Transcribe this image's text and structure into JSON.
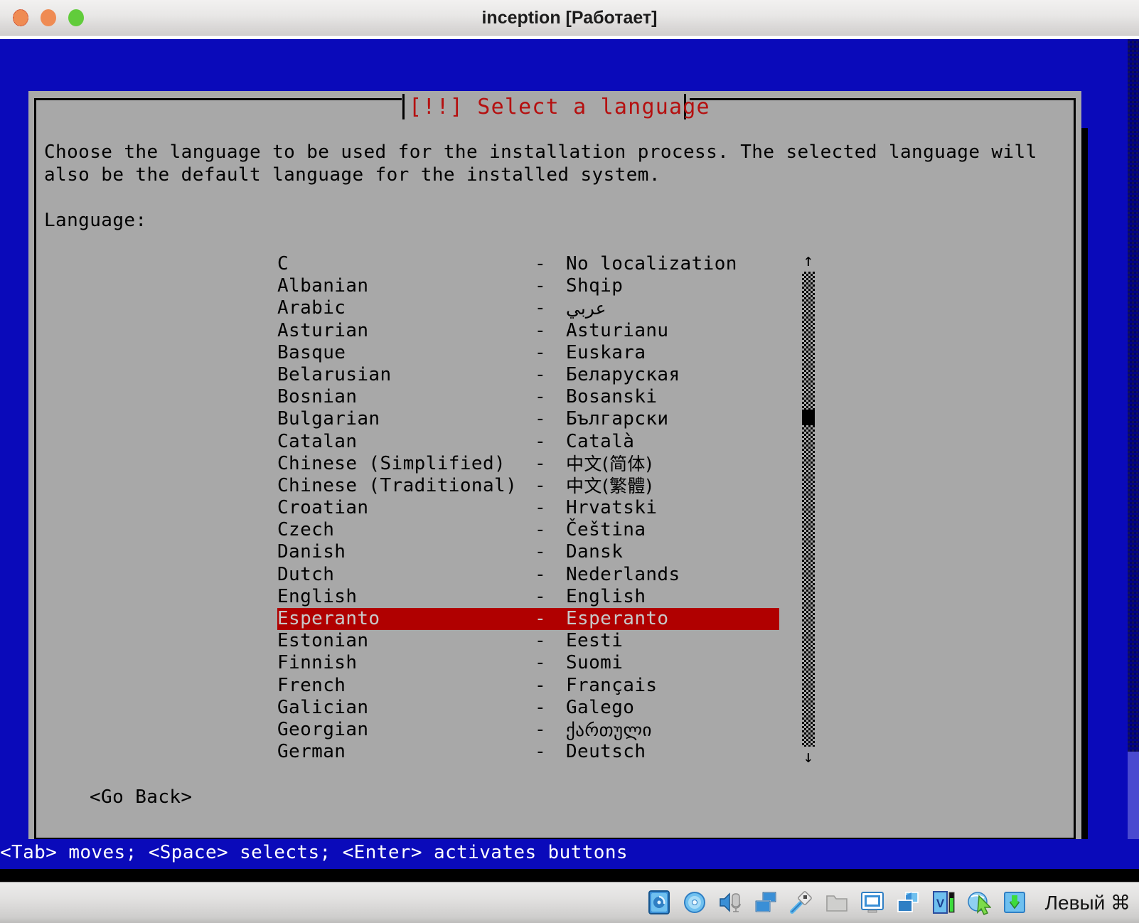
{
  "window": {
    "title": "inception [Работает]",
    "controls": [
      {
        "name": "close",
        "color": "#ef8b53"
      },
      {
        "name": "minimize",
        "color": "#ef8b53"
      },
      {
        "name": "zoom",
        "color": "#61cc3b"
      }
    ]
  },
  "dialog": {
    "title": "[!!] Select a language",
    "title_color": "#b51010",
    "background": "#a8a8a8",
    "description_line1": "Choose the language to be used for the installation process. The selected language will",
    "description_line2": "also be the default language for the installed system.",
    "list_label": "Language:",
    "go_back": "<Go Back>",
    "selected_index": 16,
    "selection_bg": "#b00000",
    "selection_fg": "#c8c8c8",
    "separator": "-",
    "languages": [
      {
        "name": "C",
        "native": "No localization",
        "script": "latin"
      },
      {
        "name": "Albanian",
        "native": "Shqip",
        "script": "latin"
      },
      {
        "name": "Arabic",
        "native": "عربي",
        "script": "rtl"
      },
      {
        "name": "Asturian",
        "native": "Asturianu",
        "script": "latin"
      },
      {
        "name": "Basque",
        "native": "Euskara",
        "script": "latin"
      },
      {
        "name": "Belarusian",
        "native": "Беларуская",
        "script": "latin"
      },
      {
        "name": "Bosnian",
        "native": "Bosanski",
        "script": "latin"
      },
      {
        "name": "Bulgarian",
        "native": "Български",
        "script": "latin"
      },
      {
        "name": "Catalan",
        "native": "Català",
        "script": "latin"
      },
      {
        "name": "Chinese (Simplified)",
        "native": "中文(简体)",
        "script": "cjk"
      },
      {
        "name": "Chinese (Traditional)",
        "native": "中文(繁體)",
        "script": "cjk"
      },
      {
        "name": "Croatian",
        "native": "Hrvatski",
        "script": "latin"
      },
      {
        "name": "Czech",
        "native": "Čeština",
        "script": "latin"
      },
      {
        "name": "Danish",
        "native": "Dansk",
        "script": "latin"
      },
      {
        "name": "Dutch",
        "native": "Nederlands",
        "script": "latin"
      },
      {
        "name": "English",
        "native": "English",
        "script": "latin"
      },
      {
        "name": "Esperanto",
        "native": "Esperanto",
        "script": "latin"
      },
      {
        "name": "Estonian",
        "native": "Eesti",
        "script": "latin"
      },
      {
        "name": "Finnish",
        "native": "Suomi",
        "script": "latin"
      },
      {
        "name": "French",
        "native": "Français",
        "script": "latin"
      },
      {
        "name": "Galician",
        "native": "Galego",
        "script": "latin"
      },
      {
        "name": "Georgian",
        "native": "ქართული",
        "script": "geo"
      },
      {
        "name": "German",
        "native": "Deutsch",
        "script": "latin"
      }
    ],
    "scrollbar": {
      "up_arrow": "↑",
      "down_arrow": "↓"
    }
  },
  "helpbar": {
    "text": "<Tab> moves; <Space> selects; <Enter> activates buttons",
    "background": "#0a0aba",
    "color": "#ffffff"
  },
  "statusbar": {
    "icons": [
      "hard-disk-icon",
      "optical-disc-icon",
      "audio-icon",
      "network-icon",
      "usb-icon",
      "shared-folder-icon",
      "display-icon",
      "video-capture-icon",
      "vm-features-icon",
      "mouse-integration-icon",
      "host-key-icon"
    ],
    "host_key_label": "Левый ⌘"
  }
}
